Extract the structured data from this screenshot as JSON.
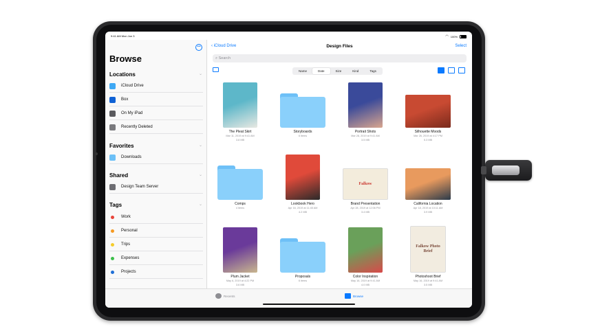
{
  "status": {
    "time": "9:41 AM   Mon Jun 3",
    "battery": "100%"
  },
  "sidebar": {
    "title": "Browse",
    "more": "•••",
    "sections": {
      "locations": "Locations",
      "favorites": "Favorites",
      "shared": "Shared",
      "tags": "Tags"
    },
    "locations": [
      "iCloud Drive",
      "Box",
      "On My iPad",
      "Recently Deleted"
    ],
    "favorites": [
      "Downloads"
    ],
    "shared": [
      "Design Team Server"
    ],
    "tags": [
      {
        "label": "Work",
        "color": "#e8443a"
      },
      {
        "label": "Personal",
        "color": "#f59a23"
      },
      {
        "label": "Trips",
        "color": "#f5cc2a"
      },
      {
        "label": "Expenses",
        "color": "#3cbf4a"
      },
      {
        "label": "Projects",
        "color": "#1f6fd6"
      }
    ],
    "colors": {
      "icloud": "#3ea8f4",
      "box": "#1062d5",
      "ipad": "#5a5a5e",
      "deleted": "#7a7a7e",
      "downloads": "#6cc0f7",
      "server": "#6e6e73"
    }
  },
  "nav": {
    "back": "iCloud Drive",
    "title": "Design Files",
    "select": "Select"
  },
  "search": {
    "placeholder": "Search"
  },
  "sort": [
    "Name",
    "Date",
    "Size",
    "Kind",
    "Tags"
  ],
  "sort_active": "Date",
  "files": [
    {
      "name": "The Pleat Skirt",
      "meta1": "Mar 11, 2019 at 9:41 AM",
      "meta2": "3.8 MB",
      "kind": "photo",
      "colors": [
        "#5db7c9",
        "#e8e8e2"
      ]
    },
    {
      "name": "Storyboards",
      "meta1": "6 items",
      "meta2": "",
      "kind": "folder",
      "colors": []
    },
    {
      "name": "Portrait Shots",
      "meta1": "Mar 28, 2019 at 9:41 AM",
      "meta2": "3.5 MB",
      "kind": "photo",
      "colors": [
        "#3a4a9a",
        "#d9a58e"
      ]
    },
    {
      "name": "Silhouette Moods",
      "meta1": "Mar 26, 2019 at 4:17 PM",
      "meta2": "5.3 MB",
      "kind": "photo",
      "colors": [
        "#c84a32",
        "#7a2a1c"
      ]
    },
    {
      "name": "Comps",
      "meta1": "4 items",
      "meta2": "",
      "kind": "folder",
      "colors": []
    },
    {
      "name": "Lookbook Hero",
      "meta1": "Apr 16, 2019 at 11:45 AM",
      "meta2": "4.2 MB",
      "kind": "photo",
      "colors": [
        "#e04a3a",
        "#2a2a2a"
      ]
    },
    {
      "name": "Brand Presentation",
      "meta1": "Apr 28, 2019 at 12:06 PM",
      "meta2": "3.4 MB",
      "kind": "doc",
      "colors": [
        "#f3ecdc",
        "#c9362e"
      ],
      "doc_text": "Falkow"
    },
    {
      "name": "California Location",
      "meta1": "Apr 18, 2019 at 10:11 AM",
      "meta2": "3.9 MB",
      "kind": "photo",
      "colors": [
        "#e89a5e",
        "#2a3a4a"
      ]
    },
    {
      "name": "Plum Jacket",
      "meta1": "May 6, 2019 at 4:22 PM",
      "meta2": "3.6 MB",
      "kind": "photo",
      "colors": [
        "#6a3a9a",
        "#c9b78e"
      ]
    },
    {
      "name": "Proposals",
      "meta1": "6 items",
      "meta2": "",
      "kind": "folder",
      "colors": []
    },
    {
      "name": "Color Inspiration",
      "meta1": "May 16, 2019 at 9:41 AM",
      "meta2": "4.0 MB",
      "kind": "photo",
      "colors": [
        "#6aa05a",
        "#d84a4a"
      ]
    },
    {
      "name": "Photoshoot Brief",
      "meta1": "May 16, 2019 at 9:41 AM",
      "meta2": "3.5 MB",
      "kind": "doc",
      "colors": [
        "#f2ece0",
        "#7a4a3a"
      ],
      "doc_text": "Falkow Photo Brief"
    }
  ],
  "tabbar": {
    "recents": "Recents",
    "browse": "Browse"
  },
  "accent": "#0a7aff",
  "folder_color": "#8ad0fb"
}
